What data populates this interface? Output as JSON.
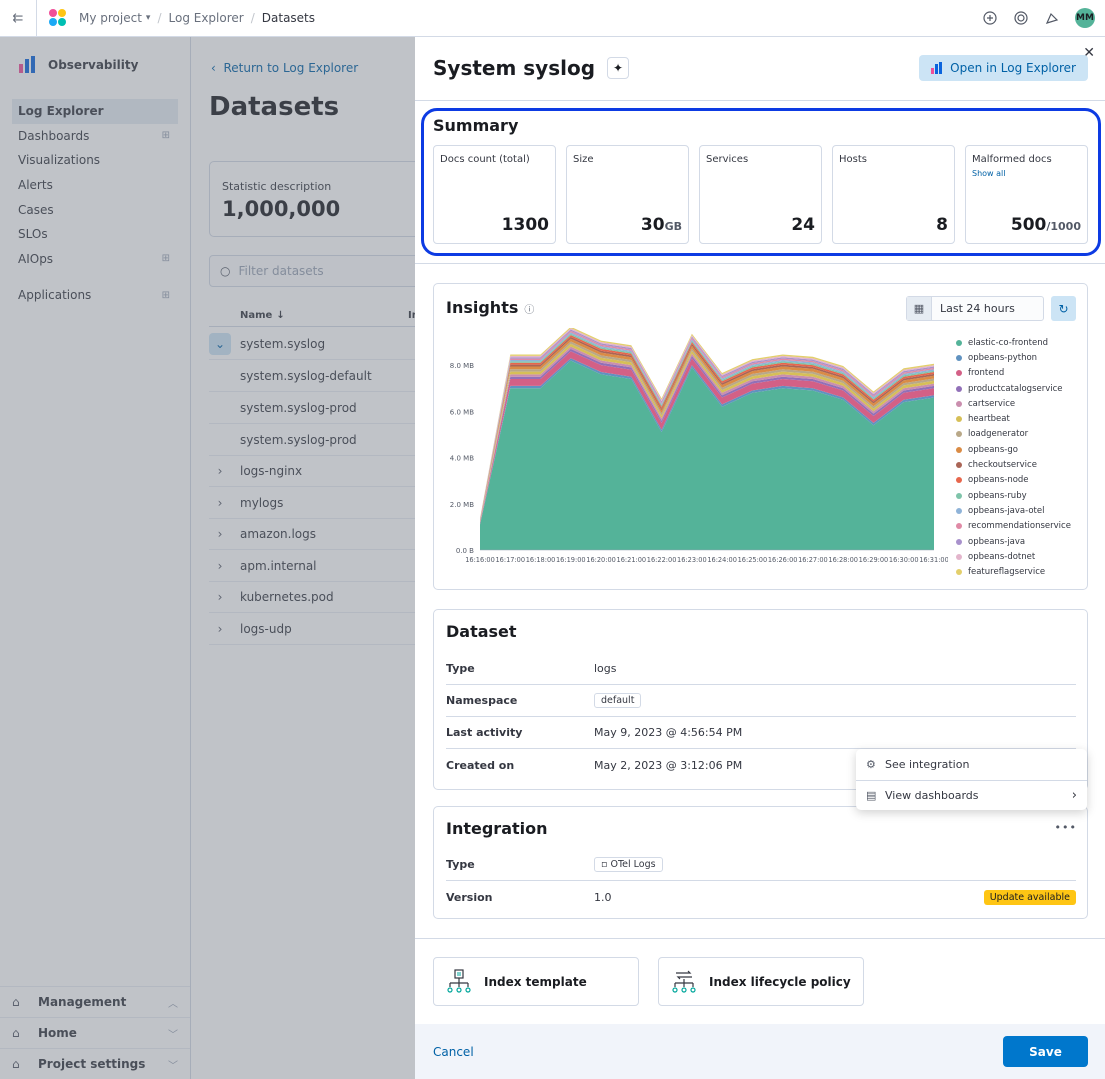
{
  "topbar": {
    "project": "My project",
    "crumb_log_explorer": "Log Explorer",
    "crumb_current": "Datasets",
    "avatar_initials": "MM",
    "icons": [
      "help-icon",
      "newsfeed-icon",
      "cheer-icon"
    ]
  },
  "sidebar": {
    "brand": "Observability",
    "items": [
      {
        "label": "Log Explorer",
        "active": true
      },
      {
        "label": "Dashboards",
        "grid": true
      },
      {
        "label": "Visualizations"
      },
      {
        "label": "Alerts"
      },
      {
        "label": "Cases"
      },
      {
        "label": "SLOs"
      },
      {
        "label": "AIOps",
        "grid": true
      }
    ],
    "applications": "Applications",
    "bottom": [
      "Management",
      "Home",
      "Project settings"
    ]
  },
  "main": {
    "back_link": "Return to Log Explorer",
    "title": "Datasets",
    "stat_description": "Statistic description",
    "stat_value": "1,000,000",
    "filter_placeholder": "Filter datasets",
    "column_name": "Name",
    "column_short": "In",
    "rows": [
      {
        "name": "system.syslog",
        "type": "expanded"
      },
      {
        "name": "system.syslog-default",
        "type": "sub"
      },
      {
        "name": "system.syslog-prod",
        "type": "sub"
      },
      {
        "name": "system.syslog-prod",
        "type": "sub"
      },
      {
        "name": "logs-nginx",
        "type": "collapsed"
      },
      {
        "name": "mylogs",
        "type": "collapsed"
      },
      {
        "name": "amazon.logs",
        "type": "collapsed"
      },
      {
        "name": "apm.internal",
        "type": "collapsed"
      },
      {
        "name": "kubernetes.pod",
        "type": "collapsed"
      },
      {
        "name": "logs-udp",
        "type": "collapsed"
      }
    ]
  },
  "flyout": {
    "title": "System syslog",
    "open_button": "Open in Log Explorer",
    "summary": {
      "title": "Summary",
      "cards": [
        {
          "label": "Docs count (total)",
          "value": "1300",
          "unit": ""
        },
        {
          "label": "Size",
          "value": "30",
          "unit": "GB"
        },
        {
          "label": "Services",
          "value": "24",
          "unit": ""
        },
        {
          "label": "Hosts",
          "value": "8",
          "unit": ""
        },
        {
          "label": "Malformed docs",
          "link": "Show all",
          "value": "500",
          "unit": "/1000"
        }
      ]
    },
    "insights": {
      "title": "Insights",
      "date_range": "Last 24 hours"
    },
    "dataset": {
      "title": "Dataset",
      "rows": [
        {
          "key": "Type",
          "value": "logs"
        },
        {
          "key": "Namespace",
          "value": "default",
          "badge": true
        },
        {
          "key": "Last activity",
          "value": "May 9, 2023 @ 4:56:54 PM"
        },
        {
          "key": "Created on",
          "value": "May 2, 2023 @ 3:12:06 PM"
        }
      ]
    },
    "popover": {
      "items": [
        "See integration",
        "View dashboards"
      ]
    },
    "integration": {
      "title": "Integration",
      "type_key": "Type",
      "type_value": "OTel Logs",
      "version_key": "Version",
      "version_value": "1.0",
      "update_badge": "Update available"
    },
    "buttons": {
      "index_template": "Index template",
      "ilm_policy": "Index lifecycle policy"
    },
    "footer": {
      "cancel": "Cancel",
      "save": "Save"
    }
  },
  "chart_data": {
    "type": "area",
    "title": "Insights",
    "x": [
      "16:16:00",
      "16:17:00",
      "16:18:00",
      "16:19:00",
      "16:20:00",
      "16:21:00",
      "16:22:00",
      "16:23:00",
      "16:24:00",
      "16:25:00",
      "16:26:00",
      "16:27:00",
      "16:28:00",
      "16:29:00",
      "16:30:00",
      "16:31:00"
    ],
    "y_ticks": [
      "0.0 B",
      "2.0 MB",
      "4.0 MB",
      "6.0 MB",
      "8.0 MB"
    ],
    "ylim": [
      0,
      9
    ],
    "stacked": true,
    "series": [
      {
        "name": "elastic-co-frontend",
        "color": "#54b399",
        "values": [
          1.1,
          7.0,
          7.0,
          8.2,
          7.6,
          7.4,
          5.1,
          7.9,
          6.2,
          6.8,
          7.0,
          6.9,
          6.5,
          5.4,
          6.4,
          6.6
        ]
      },
      {
        "name": "opbeans-python",
        "color": "#6092c0",
        "values": [
          0.02,
          0.1,
          0.1,
          0.1,
          0.1,
          0.1,
          0.1,
          0.1,
          0.1,
          0.1,
          0.1,
          0.1,
          0.1,
          0.1,
          0.1,
          0.1
        ]
      },
      {
        "name": "frontend",
        "color": "#d36086",
        "values": [
          0.05,
          0.3,
          0.3,
          0.3,
          0.3,
          0.3,
          0.3,
          0.3,
          0.3,
          0.3,
          0.3,
          0.3,
          0.3,
          0.3,
          0.3,
          0.3
        ]
      },
      {
        "name": "productcatalogservice",
        "color": "#9170b8",
        "values": [
          0.02,
          0.1,
          0.1,
          0.1,
          0.1,
          0.1,
          0.1,
          0.1,
          0.1,
          0.1,
          0.1,
          0.1,
          0.1,
          0.1,
          0.1,
          0.1
        ]
      },
      {
        "name": "cartservice",
        "color": "#ca8eae",
        "values": [
          0.02,
          0.1,
          0.1,
          0.1,
          0.1,
          0.1,
          0.1,
          0.1,
          0.1,
          0.1,
          0.1,
          0.1,
          0.1,
          0.1,
          0.1,
          0.1
        ]
      },
      {
        "name": "heartbeat",
        "color": "#d6bf57",
        "values": [
          0.02,
          0.12,
          0.12,
          0.12,
          0.12,
          0.12,
          0.12,
          0.12,
          0.12,
          0.12,
          0.12,
          0.12,
          0.12,
          0.12,
          0.12,
          0.12
        ]
      },
      {
        "name": "loadgenerator",
        "color": "#b9a888",
        "values": [
          0.02,
          0.1,
          0.1,
          0.1,
          0.1,
          0.1,
          0.1,
          0.1,
          0.1,
          0.1,
          0.1,
          0.1,
          0.1,
          0.1,
          0.1,
          0.1
        ]
      },
      {
        "name": "opbeans-go",
        "color": "#da8b45",
        "values": [
          0.02,
          0.12,
          0.12,
          0.12,
          0.12,
          0.12,
          0.12,
          0.12,
          0.12,
          0.12,
          0.12,
          0.12,
          0.12,
          0.12,
          0.12,
          0.12
        ]
      },
      {
        "name": "checkoutservice",
        "color": "#aa6556",
        "values": [
          0.02,
          0.08,
          0.08,
          0.08,
          0.08,
          0.08,
          0.08,
          0.08,
          0.08,
          0.08,
          0.08,
          0.08,
          0.08,
          0.08,
          0.08,
          0.08
        ]
      },
      {
        "name": "opbeans-node",
        "color": "#e7664c",
        "values": [
          0.02,
          0.08,
          0.08,
          0.08,
          0.08,
          0.08,
          0.08,
          0.08,
          0.08,
          0.08,
          0.08,
          0.08,
          0.08,
          0.08,
          0.08,
          0.08
        ]
      },
      {
        "name": "opbeans-ruby",
        "color": "#7fc4aa",
        "values": [
          0.01,
          0.06,
          0.06,
          0.06,
          0.06,
          0.06,
          0.06,
          0.06,
          0.06,
          0.06,
          0.06,
          0.06,
          0.06,
          0.06,
          0.06,
          0.06
        ]
      },
      {
        "name": "opbeans-java-otel",
        "color": "#8fb3d8",
        "values": [
          0.01,
          0.06,
          0.06,
          0.06,
          0.06,
          0.06,
          0.06,
          0.06,
          0.06,
          0.06,
          0.06,
          0.06,
          0.06,
          0.06,
          0.06,
          0.06
        ]
      },
      {
        "name": "recommendationservice",
        "color": "#e08aa6",
        "values": [
          0.01,
          0.06,
          0.06,
          0.06,
          0.06,
          0.06,
          0.06,
          0.06,
          0.06,
          0.06,
          0.06,
          0.06,
          0.06,
          0.06,
          0.06,
          0.06
        ]
      },
      {
        "name": "opbeans-java",
        "color": "#a891cc",
        "values": [
          0.01,
          0.06,
          0.06,
          0.06,
          0.06,
          0.06,
          0.06,
          0.06,
          0.06,
          0.06,
          0.06,
          0.06,
          0.06,
          0.06,
          0.06,
          0.06
        ]
      },
      {
        "name": "opbeans-dotnet",
        "color": "#e3b5cc",
        "values": [
          0.01,
          0.06,
          0.06,
          0.06,
          0.06,
          0.06,
          0.06,
          0.06,
          0.06,
          0.06,
          0.06,
          0.06,
          0.06,
          0.06,
          0.06,
          0.06
        ]
      },
      {
        "name": "featureflagservice",
        "color": "#e3cf6b",
        "values": [
          0.01,
          0.06,
          0.06,
          0.06,
          0.06,
          0.06,
          0.06,
          0.06,
          0.06,
          0.06,
          0.06,
          0.06,
          0.06,
          0.06,
          0.06,
          0.06
        ]
      }
    ]
  }
}
